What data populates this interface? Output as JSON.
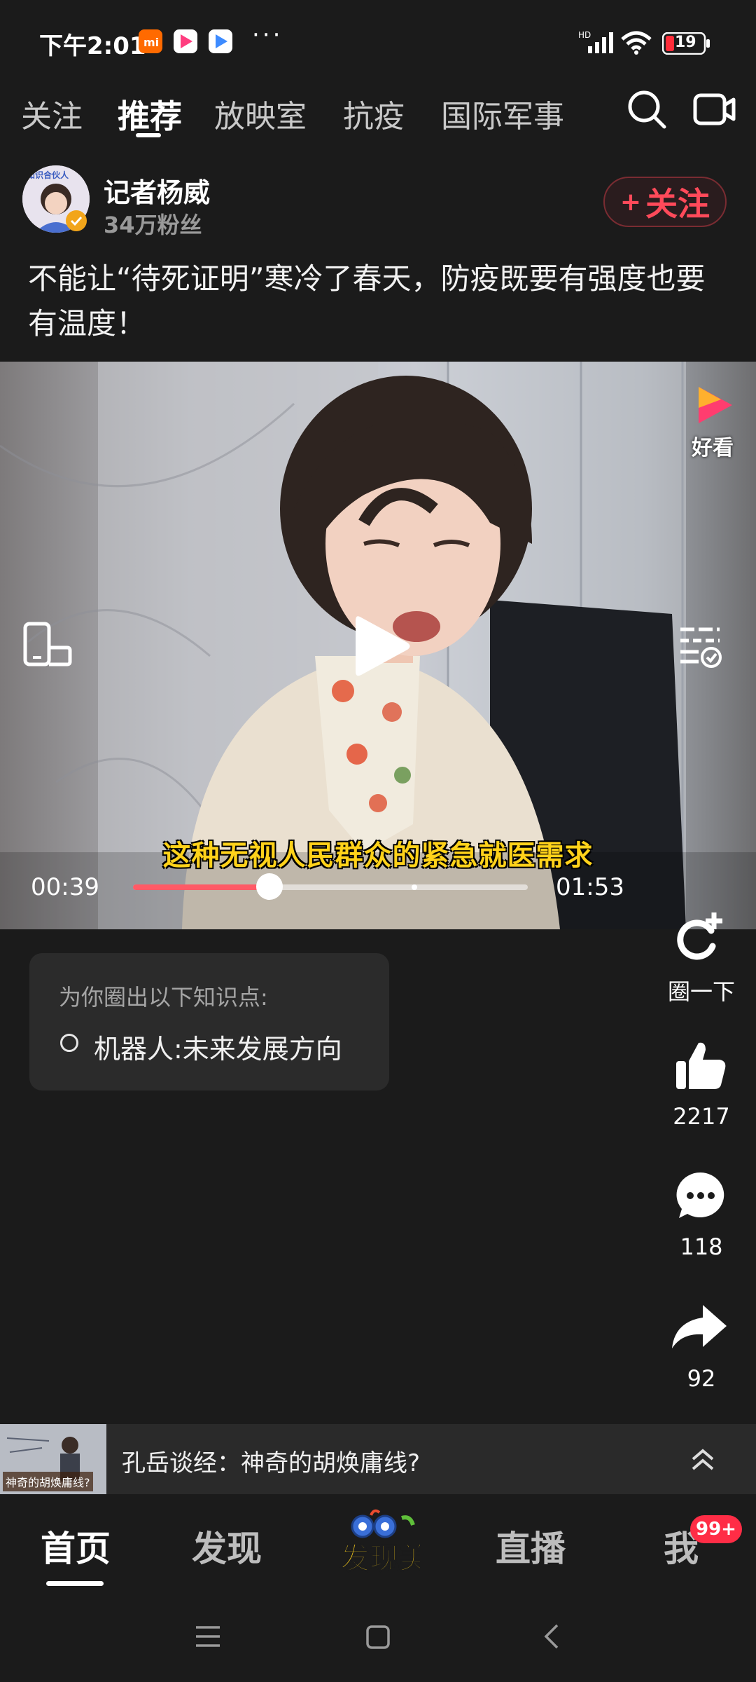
{
  "status_bar": {
    "time": "下午2:01",
    "dots": "···",
    "battery": "19",
    "network_label": "HD"
  },
  "top_tabs": [
    {
      "label": "关注",
      "active": false
    },
    {
      "label": "推荐",
      "active": true
    },
    {
      "label": "放映室",
      "active": false
    },
    {
      "label": "抗疫",
      "active": false
    },
    {
      "label": "国际军事",
      "active": false
    }
  ],
  "author": {
    "name": "记者杨威",
    "fans": "34万粉丝",
    "badge_text": "知识合伙人",
    "follow_label": "关注",
    "follow_plus": "+"
  },
  "post": {
    "title": "不能让“待死证明”寒冷了春天，防疫既要有强度也要有温度！"
  },
  "video": {
    "platform_label": "好看",
    "subtitle": "这种无视人民群众的紧急就医需求",
    "current_time": "00:39",
    "total_time": "01:53",
    "progress": 0.345
  },
  "knowledge": {
    "title": "为你圈出以下知识点:",
    "item": "机器人:未来发展方向"
  },
  "actions": {
    "circle_label": "圈一下",
    "likes": "2217",
    "comments": "118",
    "shares": "92"
  },
  "next_video": {
    "title": "孔岳谈经：神奇的胡焕庸线?",
    "thumb_caption": "神奇的胡焕庸线?"
  },
  "bottom_nav": {
    "items": [
      "首页",
      "发现",
      "直播",
      "我"
    ],
    "discover_logo_text": "发现美",
    "badge": "99+"
  },
  "colors": {
    "background": "#1b1b1b",
    "accent_red": "#ff4a5a",
    "subtitle_yellow": "#ffd21a",
    "progress_red": "#ff5a66"
  }
}
